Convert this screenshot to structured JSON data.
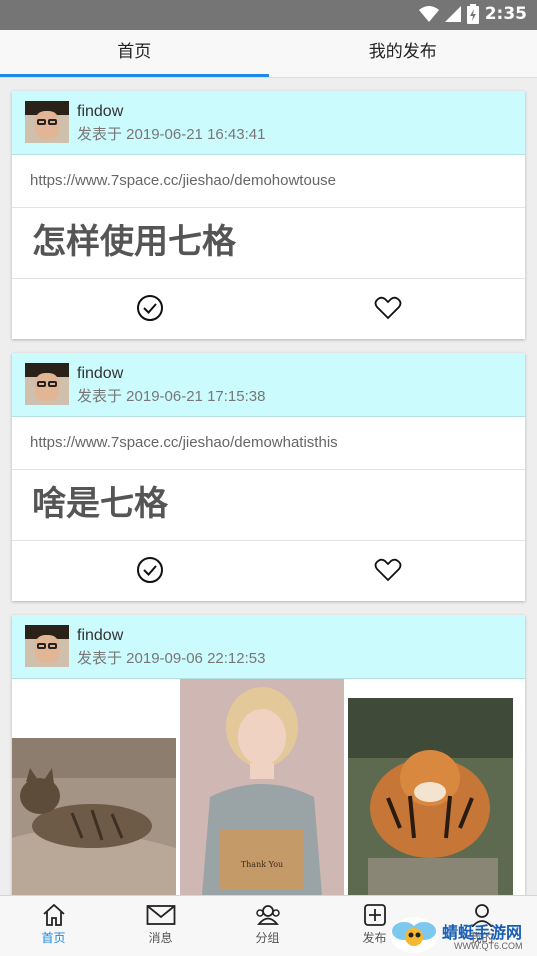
{
  "status_bar": {
    "time": "2:35"
  },
  "tabs": [
    {
      "label": "首页",
      "active": true
    },
    {
      "label": "我的发布",
      "active": false
    }
  ],
  "posts": [
    {
      "author": "findow",
      "posted": "发表于 2019-06-21 16:43:41",
      "link": "https://www.7space.cc/jieshao/demohowtouse",
      "title": "怎样使用七格"
    },
    {
      "author": "findow",
      "posted": "发表于 2019-06-21 17:15:38",
      "link": "https://www.7space.cc/jieshao/demowhatisthis",
      "title": "啥是七格"
    },
    {
      "author": "findow",
      "posted": "发表于 2019-09-06 22:12:53",
      "photos": [
        "cat-photo",
        "person-photo",
        "tiger-photo"
      ],
      "photo_text": "Thank You"
    }
  ],
  "bottom_nav": [
    {
      "label": "首页",
      "icon": "home-icon",
      "active": true
    },
    {
      "label": "消息",
      "icon": "mail-icon",
      "active": false
    },
    {
      "label": "分组",
      "icon": "group-icon",
      "active": false
    },
    {
      "label": "发布",
      "icon": "plus-square-icon",
      "active": false
    },
    {
      "label": "我的",
      "icon": "user-icon",
      "active": false
    }
  ],
  "watermark": {
    "text": "蜻蜓手游网",
    "url": "WWW.QT6.COM"
  },
  "colors": {
    "accent": "#1e88e5",
    "card_header": "#ccfbfe",
    "status_bar": "#757575"
  }
}
